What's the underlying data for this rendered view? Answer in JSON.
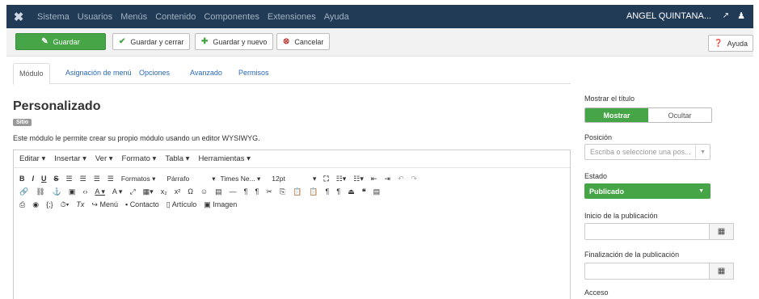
{
  "nav": {
    "items": [
      "Sistema",
      "Usuarios",
      "Menús",
      "Contenido",
      "Componentes",
      "Extensiones",
      "Ayuda"
    ],
    "user": "ANGEL QUINTANA..."
  },
  "toolbar": {
    "save": "Guardar",
    "save_close": "Guardar y cerrar",
    "save_new": "Guardar y nuevo",
    "cancel": "Cancelar",
    "help": "Ayuda"
  },
  "tabs": [
    "Módulo",
    "Asignación de menú",
    "Opciones",
    "Avanzado",
    "Permisos"
  ],
  "module": {
    "title": "Personalizado",
    "badge": "Sitio",
    "description": "Este módulo le permite crear su propio módulo usando un editor WYSIWYG."
  },
  "editor": {
    "menus": [
      "Editar ▾",
      "Insertar ▾",
      "Ver ▾",
      "Formato ▾",
      "Tabla ▾",
      "Herramientas ▾"
    ],
    "formats": "Formatos ▾",
    "block": "Párrafo",
    "font": "Times Ne... ▾",
    "size": "12pt",
    "btn_menu": "Menú",
    "btn_contacto": "Contacto",
    "btn_articulo": "Artículo",
    "btn_imagen": "Imagen"
  },
  "sidebar": {
    "show_title_label": "Mostrar el título",
    "show": "Mostrar",
    "hide": "Ocultar",
    "position_label": "Posición",
    "position_placeholder": "Escriba o seleccione una pos...",
    "state_label": "Estado",
    "state_value": "Publicado",
    "publish_start_label": "Inicio de la publicación",
    "publish_end_label": "Finalización de la publicación",
    "access_label": "Acceso"
  },
  "colors": {
    "nav": "#213a55",
    "green": "#46a546",
    "link": "#2a69b8"
  }
}
